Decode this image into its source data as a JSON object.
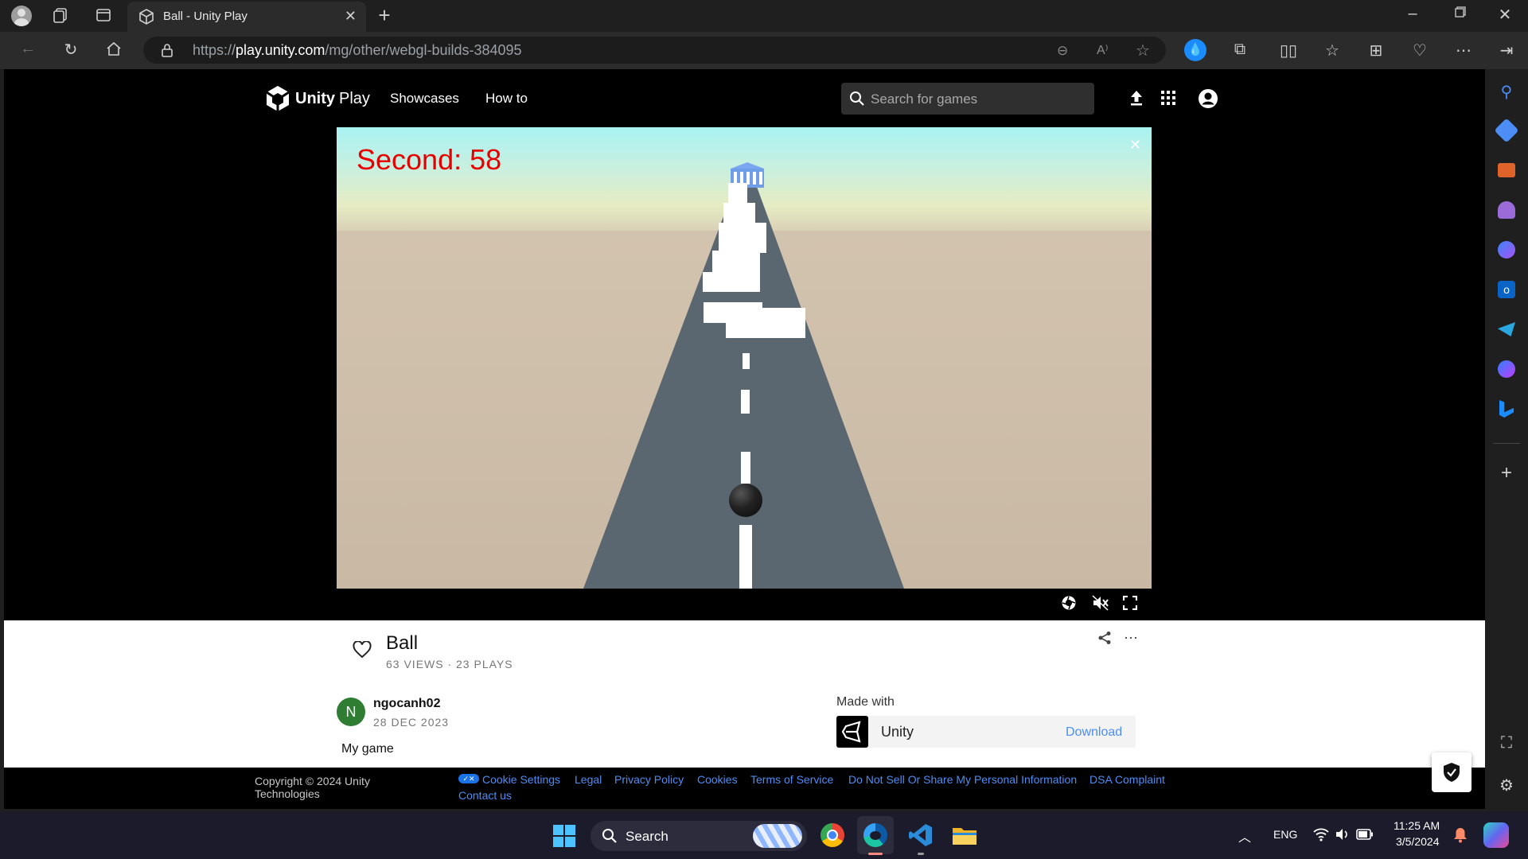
{
  "browser": {
    "tab_title": "Ball - Unity Play",
    "url_prefix": "https://",
    "url_domain": "play.unity.com",
    "url_path": "/mg/other/webgl-builds-384095"
  },
  "nav": {
    "brand": "Unity",
    "brand_suffix": "Play",
    "links": [
      "Showcases",
      "How to"
    ],
    "search_placeholder": "Search for games"
  },
  "game": {
    "score_text": "Second: 58",
    "score_color": "#e60000"
  },
  "info": {
    "title": "Ball",
    "stats": "63 VIEWS · 23 PLAYS",
    "author_initial": "N",
    "author": "ngocanh02",
    "date": "28 DEC 2023",
    "description": "My game",
    "made_with_label": "Made with",
    "engine": "Unity",
    "download_label": "Download"
  },
  "footer": {
    "copyright": "Copyright © 2024 Unity Technologies",
    "links": [
      "Cookie Settings",
      "Legal",
      "Privacy Policy",
      "Cookies",
      "Terms of Service",
      "Do Not Sell Or Share My Personal Information",
      "DSA Complaint"
    ],
    "contact": "Contact us"
  },
  "taskbar": {
    "search_label": "Search",
    "lang": "ENG",
    "time": "11:25 AM",
    "date": "3/5/2024"
  },
  "colors": {
    "link": "#4c8df6",
    "avatar": "#2e7d32",
    "road": "#5b6770"
  }
}
